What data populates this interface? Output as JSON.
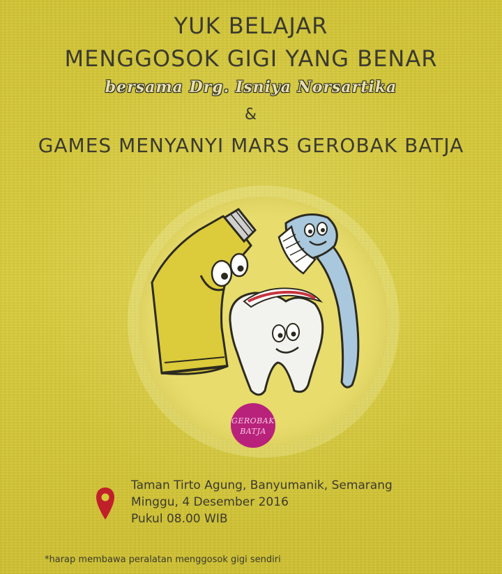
{
  "poster": {
    "title_line1": "YUK BELAJAR",
    "title_line2": "MENGGOSOK GIGI YANG BENAR",
    "subtitle": "bersama Drg. Isniya Norsartika",
    "ampersand": "&",
    "games_line": "GAMES MENYANYI MARS GEROBAK BATJA"
  },
  "logo": {
    "line1": "GEROBAK",
    "line2": "BATJA",
    "color": "#b8227b"
  },
  "event": {
    "location": "Taman Tirto Agung, Banyumanik, Semarang",
    "date": "Minggu, 4 Desember 2016",
    "time": "Pukul 08.00 WIB",
    "pin_icon": "location-pin-icon",
    "pin_color": "#c0202a"
  },
  "note": "*harap membawa peralatan menggosok gigi sendiri",
  "colors": {
    "background": "#d6c93a",
    "text": "#3b3a2e"
  }
}
